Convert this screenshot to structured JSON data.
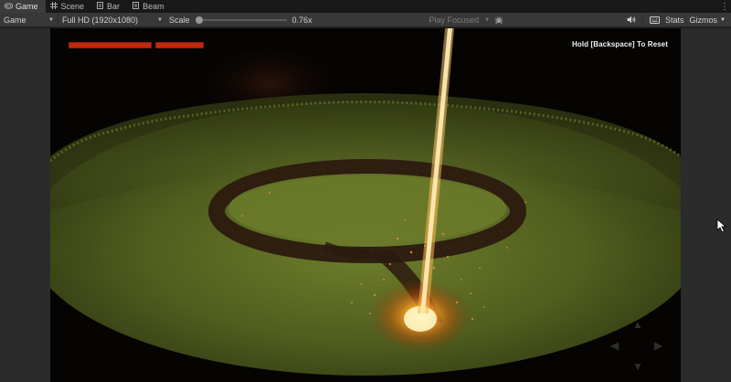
{
  "tabs": [
    {
      "label": "Game",
      "icon": "gamepad-icon",
      "active": true
    },
    {
      "label": "Scene",
      "icon": "scene-grid-icon",
      "active": false
    },
    {
      "label": "Bar",
      "icon": "script-icon",
      "active": false
    },
    {
      "label": "Beam",
      "icon": "script-icon",
      "active": false
    }
  ],
  "toolbar": {
    "display_mode": "Game",
    "resolution": "Full HD (1920x1080)",
    "scale_label": "Scale",
    "scale_value": "0.76x",
    "play_mode": "Play Focused",
    "stats_label": "Stats",
    "gizmos_label": "Gizmos"
  },
  "hud": {
    "reset_hint": "Hold [Backspace] To Reset",
    "bar_color": "#c2280c"
  },
  "colors": {
    "beam": "#ffb347",
    "grass": "#5a6a22",
    "scorch": "#2a1a10"
  }
}
